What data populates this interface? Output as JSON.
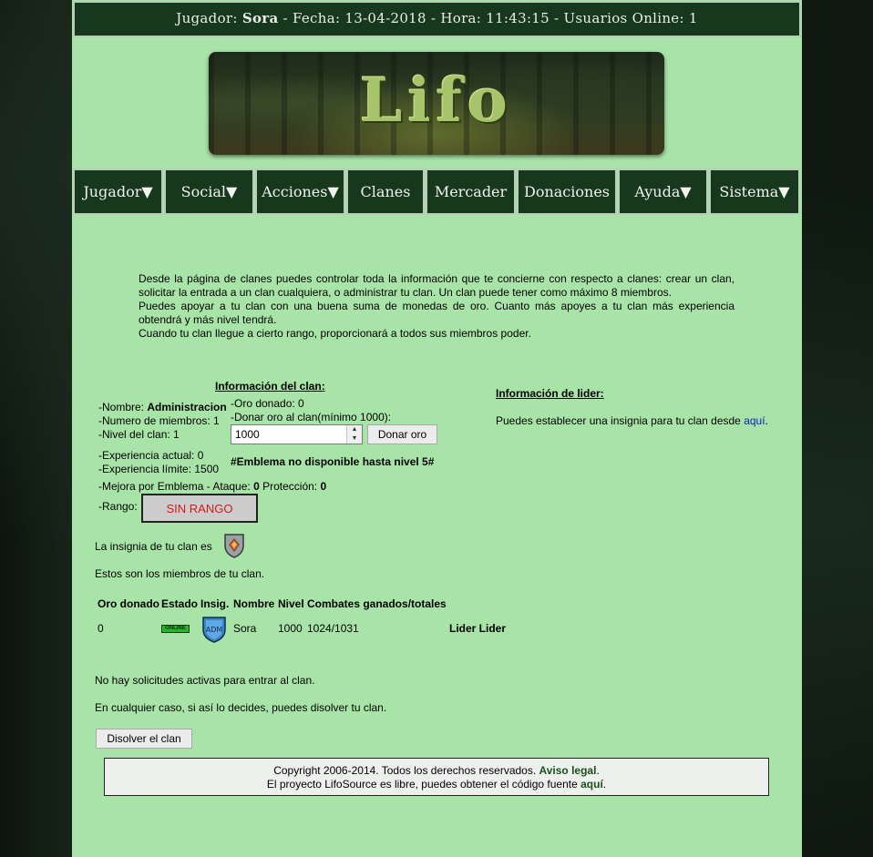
{
  "topbar": {
    "player_label": "Jugador:",
    "player_name": "Sora",
    "rest": " - Fecha: 13-04-2018 - Hora: 11:43:15 - Usuarios Online: 1"
  },
  "banner": {
    "logo_text": "Lifo"
  },
  "nav": [
    {
      "label": "Jugador▼"
    },
    {
      "label": "Social▼"
    },
    {
      "label": "Acciones▼"
    },
    {
      "label": "Clanes"
    },
    {
      "label": "Mercader"
    },
    {
      "label": "Donaciones"
    },
    {
      "label": "Ayuda▼"
    },
    {
      "label": "Sistema▼"
    }
  ],
  "intro": {
    "p1": "Desde la página de clanes puedes controlar toda la información que te concierne con respecto a clanes: crear un clan, solicitar la entrada a un clan cualquiera, o administrar tu clan. Un clan puede tener como máximo 8 miembros.",
    "p2": "Puedes apoyar a tu clan con una buena suma de monedas de oro. Cuanto más apoyes a tu clan más experiencia obtendrá y más nivel tendrá.",
    "p3": "Cuando tu clan llegue a cierto rango, proporcionará a todos sus miembros poder."
  },
  "clan_info": {
    "heading": "Información del clan:",
    "name_label": "-Nombre: ",
    "name_value": "Administracion",
    "members": "-Numero de miembros: 1",
    "level": "-Nivel del clan: 1",
    "gold_donated": "-Oro donado: 0",
    "donate_label": "-Donar oro al clan(mínimo 1000):",
    "donate_value": "1000",
    "donate_button": "Donar oro",
    "exp_current": "-Experiencia actual: 0",
    "exp_limit": "-Experiencia límite: 1500",
    "emblem_note": "#Emblema no disponible hasta nivel 5#",
    "upgrade_label": "-Mejora por Emblema - Ataque: ",
    "upgrade_attack": "0",
    "upgrade_prot_label": " Protección: ",
    "upgrade_prot": "0",
    "rank_label": "-Rango:",
    "rank_value": "SIN RANGO"
  },
  "leader_info": {
    "heading": "Información de lider:",
    "text": "Puedes establecer una insignia para tu clan desde ",
    "link": "aquí",
    "dot": "."
  },
  "insignia_text": "La insignia de tu clan es",
  "members_intro": "Estos son los miembros de tu clan.",
  "members_table": {
    "headers": [
      "Oro donado",
      "Estado",
      "Insig.",
      "Nombre",
      "Nivel",
      "Combates ganados/totales"
    ],
    "rows": [
      {
        "gold": "0",
        "status": "ONLINE",
        "insignia": "ADM",
        "name": "Sora",
        "level": "1000",
        "combats": "1024/1031",
        "role": "Lider Lider"
      }
    ]
  },
  "no_requests": "No hay solicitudes activas para entrar al clan.",
  "dissolve_text": "En cualquier caso, si así lo decides, puedes disolver tu clan.",
  "dissolve_button": "Disolver el clan",
  "footer": {
    "line1_text": "Copyright 2006-2014. Todos los derechos reservados. ",
    "line1_link": "Aviso legal",
    "line1_end": ".",
    "line2_text": "El proyecto LifoSource es libre, puedes obtener el código fuente ",
    "line2_link": "aquí",
    "line2_end": "."
  },
  "colors": {
    "page_bg": "#a8e3a8",
    "nav_bg": "#17381c",
    "rank_text": "#d41919",
    "link_green": "#1b4f1b",
    "link_blue": "#0b21c9"
  }
}
